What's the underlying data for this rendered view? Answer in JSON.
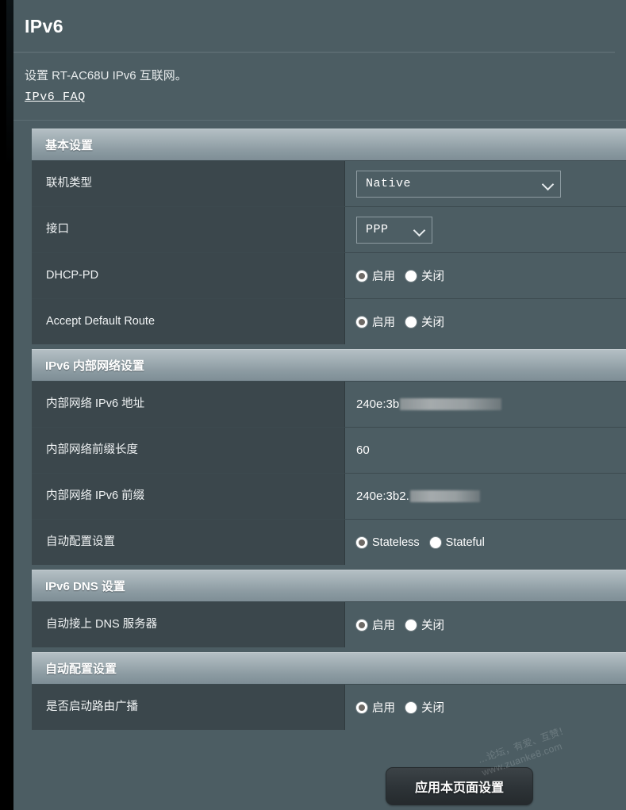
{
  "page": {
    "title": "IPv6",
    "description": "设置 RT-AC68U IPv6 互联网。",
    "faq_link": "IPv6  FAQ"
  },
  "sections": [
    {
      "heading": "基本设置",
      "rows": [
        {
          "label": "联机类型",
          "control": "select",
          "value": "Native"
        },
        {
          "label": "接口",
          "control": "select",
          "value": "PPP"
        },
        {
          "label": "DHCP-PD",
          "control": "radio",
          "options": [
            "启用",
            "关闭"
          ],
          "selected": "启用"
        },
        {
          "label": "Accept Default Route",
          "control": "radio",
          "options": [
            "启用",
            "关闭"
          ],
          "selected": "启用"
        }
      ]
    },
    {
      "heading": "IPv6 内部网络设置",
      "rows": [
        {
          "label": "内部网络 IPv6 地址",
          "control": "text",
          "value": "240e:3b"
        },
        {
          "label": "内部网络前缀长度",
          "control": "text",
          "value": "60"
        },
        {
          "label": "内部网络 IPv6 前缀",
          "control": "text",
          "value": "240e:3b2."
        },
        {
          "label": "自动配置设置",
          "control": "radio",
          "options": [
            "Stateless",
            "Stateful"
          ],
          "selected": "Stateless"
        }
      ]
    },
    {
      "heading": "IPv6 DNS 设置",
      "rows": [
        {
          "label": "自动接上 DNS 服务器",
          "control": "radio",
          "options": [
            "启用",
            "关闭"
          ],
          "selected": "启用"
        }
      ]
    },
    {
      "heading": "自动配置设置",
      "rows": [
        {
          "label": "是否启动路由广播",
          "control": "radio",
          "options": [
            "启用",
            "关闭"
          ],
          "selected": "启用"
        }
      ]
    }
  ],
  "footer": {
    "apply_label": "应用本页面设置"
  },
  "watermark": {
    "line1": "…论坛，有爱、互赞！",
    "line2": "www.zuanke8.com"
  },
  "colors": {
    "page_background": "#4c5d63",
    "label_cell": "#3b474c",
    "section_header_top": "#b4bfc4",
    "section_header_bottom": "#7e8e96",
    "gutter": "#000000",
    "apply_button": "#2d3337"
  }
}
